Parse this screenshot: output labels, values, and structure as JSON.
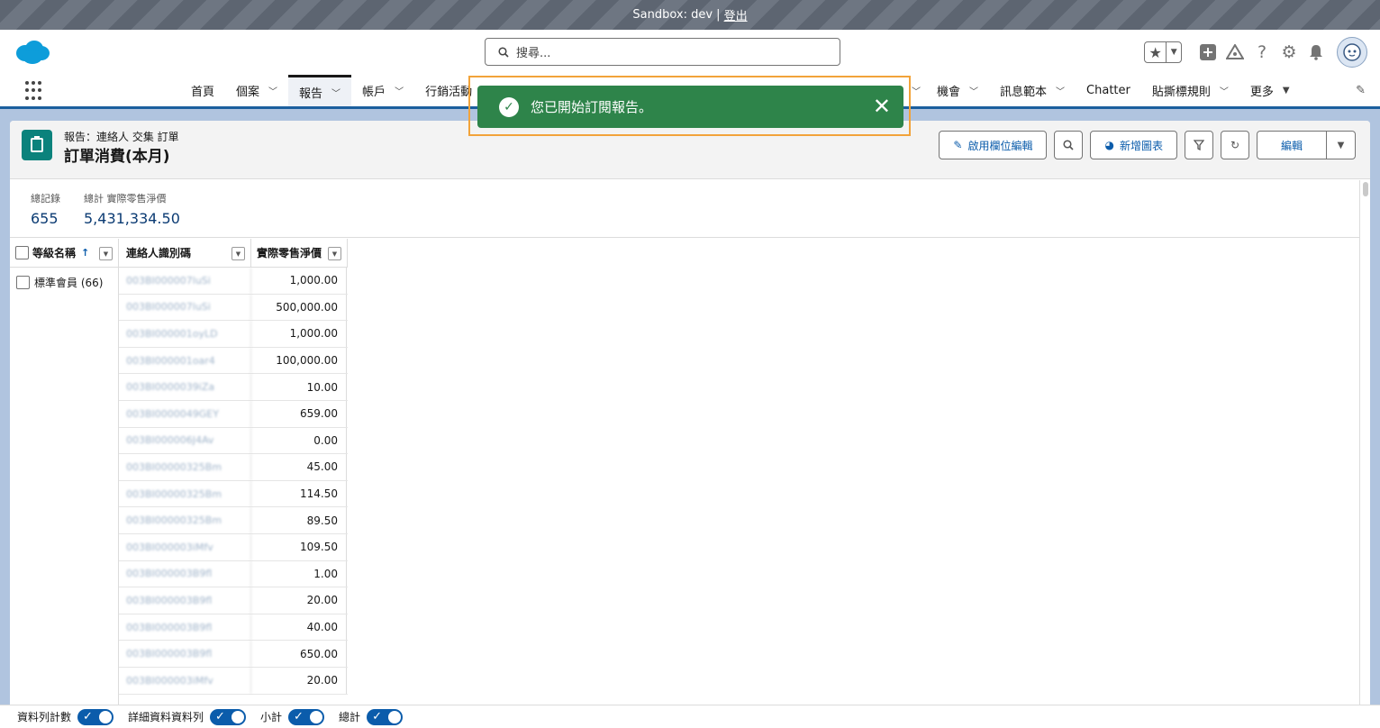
{
  "sandbox": {
    "label": "Sandbox: dev |",
    "logout": "登出"
  },
  "search": {
    "placeholder": "搜尋..."
  },
  "nav": {
    "items_left": [
      {
        "label": "首頁",
        "dropdown": false,
        "active": false
      },
      {
        "label": "個案",
        "dropdown": true,
        "active": false
      },
      {
        "label": "報告",
        "dropdown": true,
        "active": true
      },
      {
        "label": "帳戶",
        "dropdown": true,
        "active": false
      },
      {
        "label": "行銷活動",
        "dropdown": false,
        "active": false
      }
    ],
    "items_right": [
      {
        "label": "",
        "dropdown": true
      },
      {
        "label": "機會",
        "dropdown": true
      },
      {
        "label": "訊息範本",
        "dropdown": true
      },
      {
        "label": "Chatter",
        "dropdown": false
      },
      {
        "label": "貼撕標規則",
        "dropdown": true
      },
      {
        "label": "更多",
        "dropdown": true
      }
    ]
  },
  "toast": {
    "message": "您已開始訂閱報告。",
    "color": "#2e844a"
  },
  "report": {
    "breadcrumb": "報告：連絡人 交集 訂單",
    "title": "訂單消費(本月)",
    "toolbar": {
      "enable_field_edit": "啟用欄位編輯",
      "add_chart": "新增圖表",
      "edit": "編輯"
    },
    "summary": {
      "total_records_label": "總記錄",
      "total_records_value": "655",
      "total_amount_label": "總計 實際零售淨價",
      "total_amount_value": "5,431,334.50"
    },
    "columns": {
      "group": "等級名稱",
      "contact_id": "連絡人識別碼",
      "amount": "實際零售淨價"
    },
    "group_label": "標準會員 (66)",
    "rows": [
      {
        "id": "003BI000007luSi",
        "amount": "1,000.00"
      },
      {
        "id": "003BI000007luSi",
        "amount": "500,000.00"
      },
      {
        "id": "003BI000001oyLD",
        "amount": "1,000.00"
      },
      {
        "id": "003BI000001oar4",
        "amount": "100,000.00"
      },
      {
        "id": "003BI0000039iZa",
        "amount": "10.00"
      },
      {
        "id": "003BI0000049GEY",
        "amount": "659.00"
      },
      {
        "id": "003BI000006J4Av",
        "amount": "0.00"
      },
      {
        "id": "003BI00000325Bm",
        "amount": "45.00"
      },
      {
        "id": "003BI00000325Bm",
        "amount": "114.50"
      },
      {
        "id": "003BI00000325Bm",
        "amount": "89.50"
      },
      {
        "id": "003BI000003iMfv",
        "amount": "109.50"
      },
      {
        "id": "003BI000003B9fl",
        "amount": "1.00"
      },
      {
        "id": "003BI000003B9fl",
        "amount": "20.00"
      },
      {
        "id": "003BI000003B9fl",
        "amount": "40.00"
      },
      {
        "id": "003BI000003B9fl",
        "amount": "650.00"
      },
      {
        "id": "003BI000003iMfv",
        "amount": "20.00"
      }
    ]
  },
  "footer": {
    "toggles": [
      {
        "label": "資料列計數",
        "on": true
      },
      {
        "label": "詳細資料資料列",
        "on": true
      },
      {
        "label": "小計",
        "on": true
      },
      {
        "label": "總計",
        "on": true
      }
    ]
  },
  "colors": {
    "brand_blue": "#0b5cab",
    "accent_teal": "#0b827c",
    "toast_green": "#2e844a",
    "highlight_orange": "#f2a33a"
  }
}
